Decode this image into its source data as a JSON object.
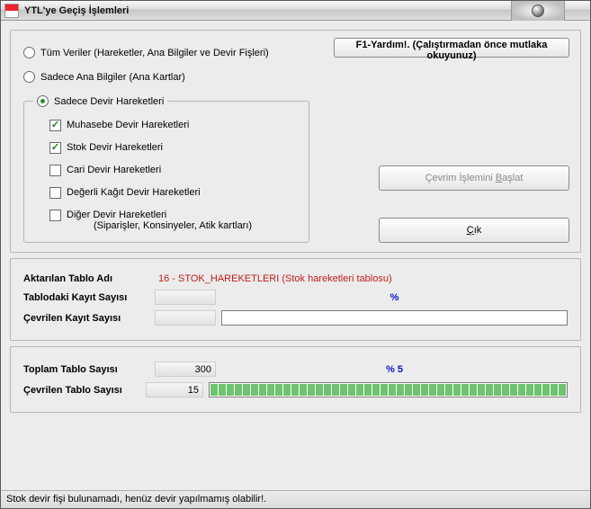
{
  "window": {
    "title": "YTL'ye Geçiş İşlemleri"
  },
  "help_button": "F1-Yardım!. (Çalıştırmadan önce mutlaka okuyunuz)",
  "radios": {
    "all": "Tüm Veriler (Hareketler, Ana Bilgiler ve Devir Fişleri)",
    "main": "Sadece Ana Bilgiler (Ana Kartlar)",
    "devir": "Sadece Devir Hareketleri"
  },
  "checks": {
    "muhasebe": "Muhasebe Devir Hareketleri",
    "stok": "Stok Devir Hareketleri",
    "cari": "Cari Devir Hareketleri",
    "dk": "Değerli Kağıt Devir Hareketleri",
    "diger": "Diğer Devir Hareketleri",
    "diger_sub": "(Siparişler, Konsinyeler, Atik kartları)"
  },
  "buttons": {
    "start_pre": "Çevrim İşlemini ",
    "start_u": "B",
    "start_post": "aşlat",
    "exit_u": "Ç",
    "exit_post": "ık"
  },
  "mid": {
    "tablo_adi_lbl": "Aktarılan Tablo Adı",
    "tablo_adi_val": "16 - STOK_HAREKETLERI (Stok hareketleri tablosu)",
    "kayit_sayisi_lbl": "Tablodaki Kayıt Sayısı",
    "kayit_sayisi_val": "",
    "kayit_pct": "%",
    "cevrilen_kayit_lbl": "Çevrilen Kayıt Sayısı",
    "cevrilen_kayit_val": ""
  },
  "bot": {
    "toplam_lbl": "Toplam Tablo Sayısı",
    "toplam_val": "300",
    "pct": "% 5",
    "cevrilen_lbl": "Çevrilen Tablo Sayısı",
    "cevrilen_val": "15"
  },
  "status": "Stok devir fişi bulunamadı, henüz devir yapılmamış olabilir!."
}
